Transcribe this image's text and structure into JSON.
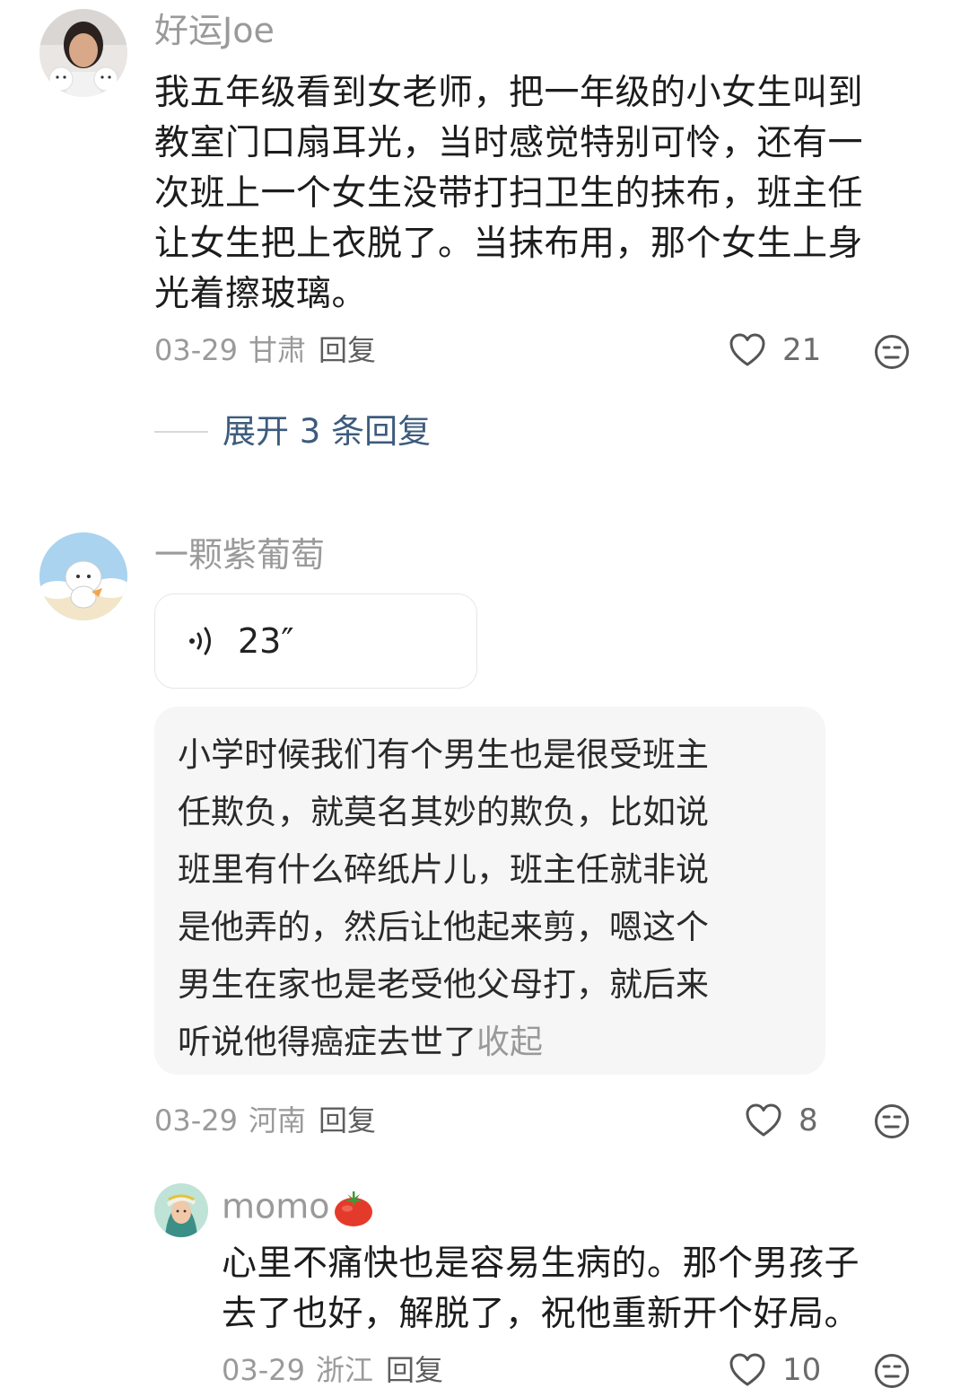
{
  "comments": [
    {
      "username": "好运Joe",
      "text": "我五年级看到女老师，把一年级的小女生叫到\n教室门口扇耳光，当时感觉特别可怜，还有一\n次班上一个女生没带打扫卫生的抹布，班主任\n让女生把上衣脱了。当抹布用，那个女生上身\n光着擦玻璃。",
      "date": "03-29",
      "region": "甘肃",
      "reply_label": "回复",
      "likes": "21",
      "expand_label": "展开 3 条回复"
    },
    {
      "username": "一颗紫葡萄",
      "voice_duration": "23″",
      "transcript": "小学时候我们有个男生也是很受班主\n任欺负，就莫名其妙的欺负，比如说\n班里有什么碎纸片儿，班主任就非说\n是他弄的，然后让他起来剪，嗯这个\n男生在家也是老受他父母打，就后来\n听说他得癌症去世了",
      "collapse_label": "收起",
      "date": "03-29",
      "region": "河南",
      "reply_label": "回复",
      "likes": "8"
    }
  ],
  "reply": {
    "username": "momo",
    "text": "心里不痛快也是容易生病的。那个男孩子\n去了也好，解脱了，祝他重新开个好局。",
    "date": "03-29",
    "region": "浙江",
    "reply_label": "回复",
    "likes": "10"
  },
  "colors": {
    "link_blue": "#3d5b7d",
    "meta_gray": "#9a9a9a",
    "bubble_bg": "#f6f6f6"
  },
  "icons": [
    "heart-outline-icon",
    "dislike-face-icon",
    "voice-wave-icon",
    "tomato-emoji-icon"
  ]
}
